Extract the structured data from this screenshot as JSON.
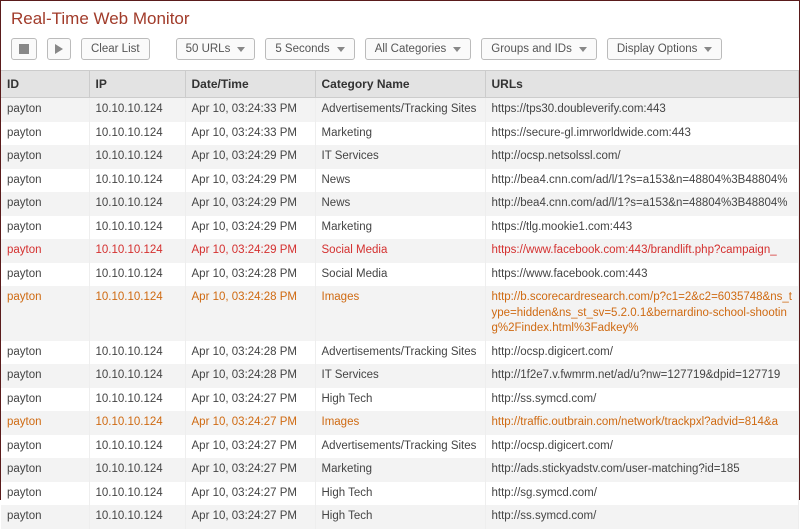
{
  "title": "Real-Time Web Monitor",
  "toolbar": {
    "clear_label": "Clear List",
    "limit_label": "50 URLs",
    "interval_label": "5 Seconds",
    "categories_label": "All Categories",
    "groups_label": "Groups and IDs",
    "display_label": "Display Options"
  },
  "columns": {
    "id": "ID",
    "ip": "IP",
    "dt": "Date/Time",
    "cat": "Category Name",
    "url": "URLs"
  },
  "rows": [
    {
      "id": "payton",
      "ip": "10.10.10.124",
      "dt": "Apr 10, 03:24:33 PM",
      "cat": "Advertisements/Tracking Sites",
      "url": "https://tps30.doubleverify.com:443",
      "style": "even"
    },
    {
      "id": "payton",
      "ip": "10.10.10.124",
      "dt": "Apr 10, 03:24:33 PM",
      "cat": "Marketing",
      "url": "https://secure-gl.imrworldwide.com:443",
      "style": "odd"
    },
    {
      "id": "payton",
      "ip": "10.10.10.124",
      "dt": "Apr 10, 03:24:29 PM",
      "cat": "IT Services",
      "url": "http://ocsp.netsolssl.com/",
      "style": "even"
    },
    {
      "id": "payton",
      "ip": "10.10.10.124",
      "dt": "Apr 10, 03:24:29 PM",
      "cat": "News",
      "url": "http://bea4.cnn.com/ad/l/1?s=a153&n=48804%3B48804%",
      "style": "odd"
    },
    {
      "id": "payton",
      "ip": "10.10.10.124",
      "dt": "Apr 10, 03:24:29 PM",
      "cat": "News",
      "url": "http://bea4.cnn.com/ad/l/1?s=a153&n=48804%3B48804%",
      "style": "even"
    },
    {
      "id": "payton",
      "ip": "10.10.10.124",
      "dt": "Apr 10, 03:24:29 PM",
      "cat": "Marketing",
      "url": "https://tlg.mookie1.com:443",
      "style": "odd"
    },
    {
      "id": "payton",
      "ip": "10.10.10.124",
      "dt": "Apr 10, 03:24:29 PM",
      "cat": "Social Media",
      "url": "https://www.facebook.com:443/brandlift.php?campaign_",
      "style": "even red"
    },
    {
      "id": "payton",
      "ip": "10.10.10.124",
      "dt": "Apr 10, 03:24:28 PM",
      "cat": "Social Media",
      "url": "https://www.facebook.com:443",
      "style": "odd"
    },
    {
      "id": "payton",
      "ip": "10.10.10.124",
      "dt": "Apr 10, 03:24:28 PM",
      "cat": "Images",
      "url": "http://b.scorecardresearch.com/p?c1=2&c2=6035748&ns_type=hidden&ns_st_sv=5.2.0.1&bernardino-school-shooting%2Findex.html%3Fadkey%",
      "style": "even orange"
    },
    {
      "id": "payton",
      "ip": "10.10.10.124",
      "dt": "Apr 10, 03:24:28 PM",
      "cat": "Advertisements/Tracking Sites",
      "url": "http://ocsp.digicert.com/",
      "style": "odd"
    },
    {
      "id": "payton",
      "ip": "10.10.10.124",
      "dt": "Apr 10, 03:24:28 PM",
      "cat": "IT Services",
      "url": "http://1f2e7.v.fwmrm.net/ad/u?nw=127719&dpid=127719",
      "style": "even"
    },
    {
      "id": "payton",
      "ip": "10.10.10.124",
      "dt": "Apr 10, 03:24:27 PM",
      "cat": "High Tech",
      "url": "http://ss.symcd.com/",
      "style": "odd"
    },
    {
      "id": "payton",
      "ip": "10.10.10.124",
      "dt": "Apr 10, 03:24:27 PM",
      "cat": "Images",
      "url": "http://traffic.outbrain.com/network/trackpxl?advid=814&a",
      "style": "even orange"
    },
    {
      "id": "payton",
      "ip": "10.10.10.124",
      "dt": "Apr 10, 03:24:27 PM",
      "cat": "Advertisements/Tracking Sites",
      "url": "http://ocsp.digicert.com/",
      "style": "odd"
    },
    {
      "id": "payton",
      "ip": "10.10.10.124",
      "dt": "Apr 10, 03:24:27 PM",
      "cat": "Marketing",
      "url": "http://ads.stickyadstv.com/user-matching?id=185",
      "style": "even"
    },
    {
      "id": "payton",
      "ip": "10.10.10.124",
      "dt": "Apr 10, 03:24:27 PM",
      "cat": "High Tech",
      "url": "http://sg.symcd.com/",
      "style": "odd"
    },
    {
      "id": "payton",
      "ip": "10.10.10.124",
      "dt": "Apr 10, 03:24:27 PM",
      "cat": "High Tech",
      "url": "http://ss.symcd.com/",
      "style": "even"
    }
  ]
}
